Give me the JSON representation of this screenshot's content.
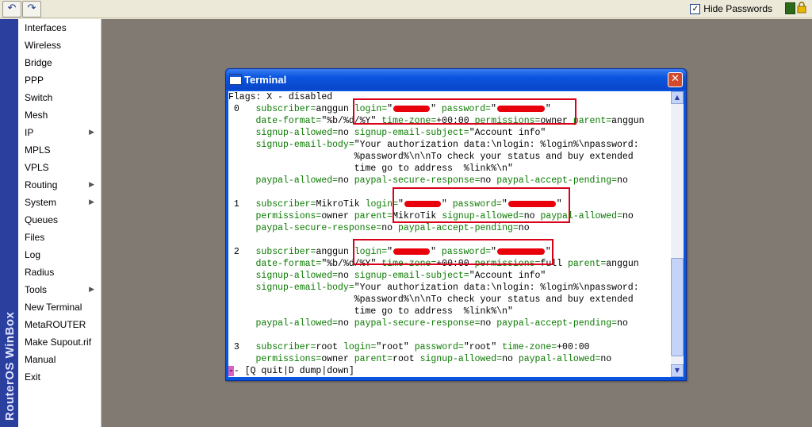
{
  "toolbar": {
    "undo_icon": "undo-icon",
    "redo_icon": "redo-icon",
    "hide_passwords_label": "Hide Passwords",
    "hide_passwords_checked": true
  },
  "brand": {
    "text": "RouterOS WinBox"
  },
  "menu": {
    "items": [
      {
        "label": "Interfaces",
        "arrow": ""
      },
      {
        "label": "Wireless",
        "arrow": ""
      },
      {
        "label": "Bridge",
        "arrow": ""
      },
      {
        "label": "PPP",
        "arrow": ""
      },
      {
        "label": "Switch",
        "arrow": ""
      },
      {
        "label": "Mesh",
        "arrow": ""
      },
      {
        "label": "IP",
        "arrow": "▶"
      },
      {
        "label": "MPLS",
        "arrow": ""
      },
      {
        "label": "VPLS",
        "arrow": ""
      },
      {
        "label": "Routing",
        "arrow": "▶"
      },
      {
        "label": "System",
        "arrow": "▶"
      },
      {
        "label": "Queues",
        "arrow": ""
      },
      {
        "label": "Files",
        "arrow": ""
      },
      {
        "label": "Log",
        "arrow": ""
      },
      {
        "label": "Radius",
        "arrow": ""
      },
      {
        "label": "Tools",
        "arrow": "▶"
      },
      {
        "label": "New Terminal",
        "arrow": ""
      },
      {
        "label": "MetaROUTER",
        "arrow": ""
      },
      {
        "label": "Make Supout.rif",
        "arrow": ""
      },
      {
        "label": "Manual",
        "arrow": ""
      },
      {
        "label": "Exit",
        "arrow": ""
      }
    ]
  },
  "terminal": {
    "title": "Terminal",
    "lines": [
      "Flags: X - disabled",
      " 0   subscriber=anggun login=\"",
      "     date-format=\"%b/%d/%Y\" time-zone=+00:00 permissions=owner parent=anggun",
      "     signup-allowed=no signup-email-subject=\"Account info\"",
      "     signup-email-body=\"Your authorization data:\\nlogin: %login%\\npassword:",
      "                       %password%\\n\\nTo check your status and buy extended",
      "                       time go to address  %link%\\n\"",
      "     paypal-allowed=no paypal-secure-response=no paypal-accept-pending=no",
      "",
      " 1   subscriber=MikroTik login=\"",
      "     permissions=owner parent=MikroTik signup-allowed=no paypal-allowed=no",
      "     paypal-secure-response=no paypal-accept-pending=no",
      "",
      " 2   subscriber=anggun login=\"",
      "     date-format=\"%b/%d/%Y\" time-zone=+00:00 permissions=full parent=anggun",
      "     signup-allowed=no signup-email-subject=\"Account info\"",
      "     signup-email-body=\"Your authorization data:\\nlogin: %login%\\npassword:",
      "                       %password%\\n\\nTo check your status and buy extended",
      "                       time go to address  %link%\\n\"",
      "     paypal-allowed=no paypal-secure-response=no paypal-accept-pending=no",
      "",
      " 3   subscriber=root login=\"root\" password=\"root\" time-zone=+00:00",
      "     permissions=owner parent=root signup-allowed=no paypal-allowed=no",
      "-- [Q quit|D dump|down]"
    ]
  }
}
